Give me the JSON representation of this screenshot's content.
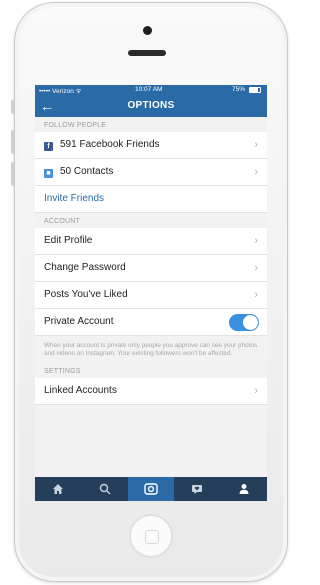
{
  "status": {
    "carrier": "••••• Verizon ᯤ",
    "time": "10:07 AM",
    "battery": "75%"
  },
  "nav": {
    "back_icon": "arrow-left-icon",
    "title": "OPTIONS"
  },
  "follow": {
    "header": "FOLLOW PEOPLE",
    "facebook": "591 Facebook Friends",
    "contacts": "50 Contacts",
    "invite": "Invite Friends"
  },
  "account": {
    "header": "ACCOUNT",
    "edit_profile": "Edit Profile",
    "change_password": "Change Password",
    "posts_liked": "Posts You've Liked",
    "private_account": "Private Account",
    "private_on": true,
    "private_note": "When your account is private only people you approve can see your photos and videos on Instagram. Your existing followers won't be affected."
  },
  "settings": {
    "header": "SETTINGS",
    "linked_accounts": "Linked Accounts"
  },
  "tabs": [
    "home-icon",
    "search-icon",
    "camera-icon",
    "activity-icon",
    "profile-icon"
  ],
  "colors": {
    "accent": "#2a6aa6",
    "tabbar": "#253e5a",
    "toggle": "#3d8fe0"
  }
}
